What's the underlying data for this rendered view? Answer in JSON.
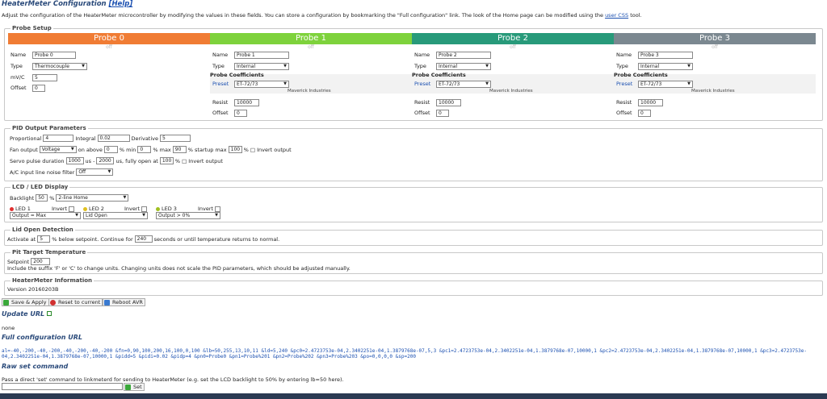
{
  "header": {
    "title": "HeaterMeter Configuration",
    "help_label": "[Help]",
    "intro_text": "Adjust the configuration of the HeaterMeter microcontroller by modifying the values in these fields. You can store a configuration by bookmarking the \"Full configuration\" link. The look of the Home page can be modified using the",
    "intro_link": "user CSS",
    "intro_tail": "tool."
  },
  "probe_setup": {
    "legend": "Probe Setup",
    "labels": {
      "name": "Name",
      "type": "Type",
      "mvc": "mV/C",
      "offset": "Offset",
      "coef": "Probe Coefficients",
      "preset": "Preset",
      "resist": "Resist"
    },
    "probes": [
      {
        "header": "Probe 0",
        "status": "off",
        "color": "#f07c34",
        "name": "Probe 0",
        "type": "Thermocouple",
        "mvc": "5",
        "offset": "0"
      },
      {
        "header": "Probe 1",
        "status": "off",
        "color": "#7ed23c",
        "name": "Probe 1",
        "type": "Internal",
        "preset": "ET-72/73",
        "manufacturer": "Maverick Industries",
        "resist": "10000",
        "offset": "0"
      },
      {
        "header": "Probe 2",
        "status": "off",
        "color": "#289a7a",
        "name": "Probe 2",
        "type": "Internal",
        "preset": "ET-72/73",
        "manufacturer": "Maverick Industries",
        "resist": "10000",
        "offset": "0"
      },
      {
        "header": "Probe 3",
        "status": "off",
        "color": "#7b8890",
        "name": "Probe 3",
        "type": "Internal",
        "preset": "ET-72/73",
        "manufacturer": "Maverick Industries",
        "resist": "10000",
        "offset": "0"
      }
    ]
  },
  "pid": {
    "legend": "PID Output Parameters",
    "proportional_label": "Proportional",
    "proportional": "4",
    "integral_label": "Integral",
    "integral": "0.02",
    "derivative_label": "Derivative",
    "derivative": "5",
    "fan_output_label": "Fan output",
    "fan_output": "Voltage",
    "on_above_label": "on above",
    "on_above": "0",
    "min_label": "% min",
    "min": "0",
    "max_label": "% max",
    "max": "90",
    "startup_label": "% startup max",
    "startup_max": "100",
    "invert_label": "% □ Invert output",
    "servo_label": "Servo pulse duration",
    "servo_min": "1000",
    "us_dash": "us -",
    "servo_max": "2000",
    "fully_open_label": "us, fully open at",
    "fully_open": "100",
    "ac_label": "A/C input line noise filter",
    "ac_filter": "Off"
  },
  "lcd": {
    "legend": "LCD / LED Display",
    "backlight_label": "Backlight",
    "backlight": "50",
    "pct": "%",
    "mode": "2-line Home",
    "invert_label": "Invert",
    "leds": [
      {
        "label": "LED 1",
        "color": "#e03030",
        "value": "Output = Max"
      },
      {
        "label": "LED 2",
        "color": "#e0c020",
        "value": "Lid Open"
      },
      {
        "label": "LED 3",
        "color": "#a0c020",
        "value": "Output > 0%"
      }
    ]
  },
  "lid": {
    "legend": "Lid Open Detection",
    "pre": "Activate at",
    "pct_value": "5",
    "mid": "% below setpoint. Continue for",
    "seconds": "240",
    "post": "seconds or until temperature returns to normal."
  },
  "pit": {
    "legend": "Pit Target Temperature",
    "setpoint_label": "Setpoint",
    "setpoint": "200",
    "note": "Include the suffix 'F' or 'C' to change units. Changing units does not scale the PID parameters, which should be adjusted manually."
  },
  "info": {
    "legend": "HeaterMeter Information",
    "version": "Version 20160203B"
  },
  "buttons": {
    "save": "Save & Apply",
    "reset": "Reset to current",
    "reboot": "Reboot AVR"
  },
  "update_url": {
    "title": "Update URL",
    "value": "none"
  },
  "full_config": {
    "title": "Full configuration URL",
    "line1": "al=-40,-200,-40,-200,-40,-200,-40,-200 &fn=0,90,100,200,16,100,0,100 &lb=50,255,13,10,11 &ld=5,240 &pc0=2.4723753e-04,2.3402251e-04,1.3879768e-07,5,3 &pc1=2.4723753e-04,2.3402251e-04,1.3879768e-07,10000,1 &pc2=2.4723753e-04,2.3402251e-04,1.3879768e-07,10000,1 &pc3=2.4723753e-",
    "line2": "04,2.3402251e-04,1.3879768e-07,10000,1 &pidd=5 &pidi=0.02 &pidp=4 &pn0=Probe0 &pn1=Probe%201 &pn2=Probe%202 &pn3=Probe%203 &po=0,0,0,0 &sp=200"
  },
  "raw": {
    "title": "Raw set command",
    "desc": "Pass a direct 'set' command to linkmeterd for sending to HeaterMeter (e.g. set the LCD backlight to 50% by entering lb=50 here).",
    "set_label": "Set"
  }
}
